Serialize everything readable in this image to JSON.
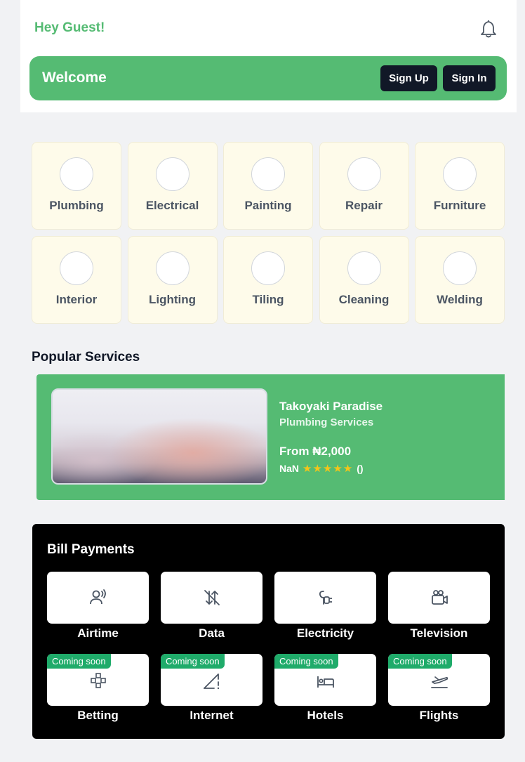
{
  "header": {
    "greeting": "Hey Guest!",
    "bell_icon": "bell-icon",
    "welcome": "Welcome",
    "signup_label": "Sign Up",
    "signin_label": "Sign In"
  },
  "categories": [
    {
      "label": "Plumbing"
    },
    {
      "label": "Electrical"
    },
    {
      "label": "Painting"
    },
    {
      "label": "Repair"
    },
    {
      "label": "Furniture"
    },
    {
      "label": "Interior"
    },
    {
      "label": "Lighting"
    },
    {
      "label": "Tiling"
    },
    {
      "label": "Cleaning"
    },
    {
      "label": "Welding"
    }
  ],
  "popular": {
    "title": "Popular Services",
    "service": {
      "name": "Takoyaki Paradise",
      "category": "Plumbing Services",
      "price": "From ₦2,000",
      "rating": "NaN",
      "stars": "★★★★★",
      "reviews": "()"
    }
  },
  "bills": {
    "title": "Bill Payments",
    "items": [
      {
        "label": "Airtime",
        "icon": "airtime-icon",
        "badge": ""
      },
      {
        "label": "Data",
        "icon": "data-icon",
        "badge": ""
      },
      {
        "label": "Electricity",
        "icon": "electricity-plug-icon",
        "badge": ""
      },
      {
        "label": "Television",
        "icon": "television-camera-icon",
        "badge": ""
      },
      {
        "label": "Betting",
        "icon": "betting-gamepad-icon",
        "badge": "Coming soon"
      },
      {
        "label": "Internet",
        "icon": "internet-signal-icon",
        "badge": "Coming soon"
      },
      {
        "label": "Hotels",
        "icon": "hotel-bed-icon",
        "badge": "Coming soon"
      },
      {
        "label": "Flights",
        "icon": "flight-takeoff-icon",
        "badge": "Coming soon"
      }
    ]
  },
  "colors": {
    "accent": "#55bb73",
    "dark": "#111827",
    "tile": "#fefbea",
    "badge": "#1fab6a",
    "star": "#f5c518"
  }
}
